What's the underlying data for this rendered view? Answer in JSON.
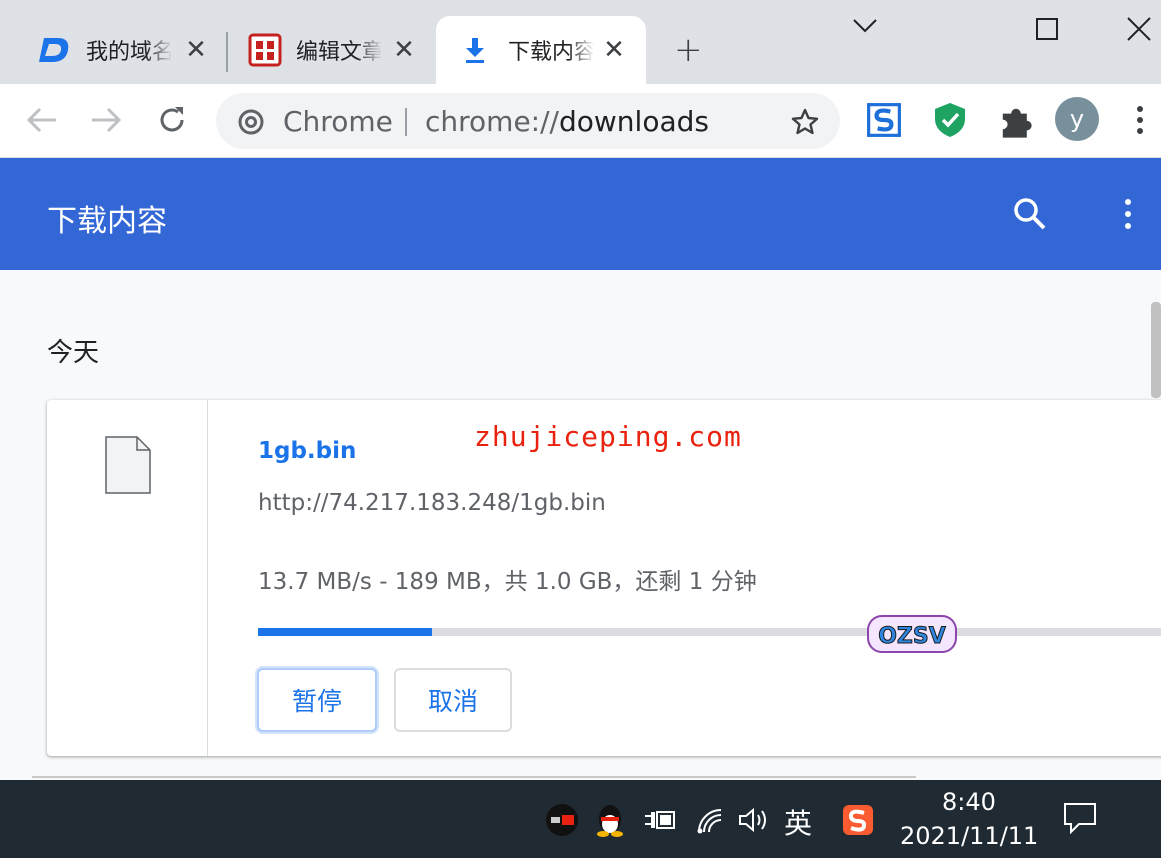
{
  "tabs": [
    {
      "label": "我的域名",
      "icon": "d-logo-icon"
    },
    {
      "label": "编辑文章",
      "icon": "seal-logo-icon"
    },
    {
      "label": "下载内容",
      "icon": "download-icon",
      "active": true
    }
  ],
  "window": {
    "min_icon": "chevron-down",
    "max_icon": "square",
    "close_icon": "x"
  },
  "omnibox": {
    "scheme_label": "Chrome",
    "url_prefix": "chrome://",
    "url_host": "downloads"
  },
  "profile": {
    "initial": "y"
  },
  "downloads": {
    "title": "下载内容",
    "section": "今天",
    "item": {
      "filename": "1gb.bin",
      "url": "http://74.217.183.248/1gb.bin",
      "status": "13.7 MB/s - 189 MB，共 1.0 GB，还剩 1 分钟",
      "progress": 0.189,
      "pause_label": "暂停",
      "cancel_label": "取消"
    }
  },
  "watermark": "zhujiceping.com",
  "ozsv_logo_text": "OZSV",
  "taskbar": {
    "lang": "英",
    "time": "8:40",
    "date": "2021/11/11"
  },
  "colors": {
    "accent": "#3367d6",
    "link": "#1a73e8",
    "taskbar": "#1f2a33"
  }
}
